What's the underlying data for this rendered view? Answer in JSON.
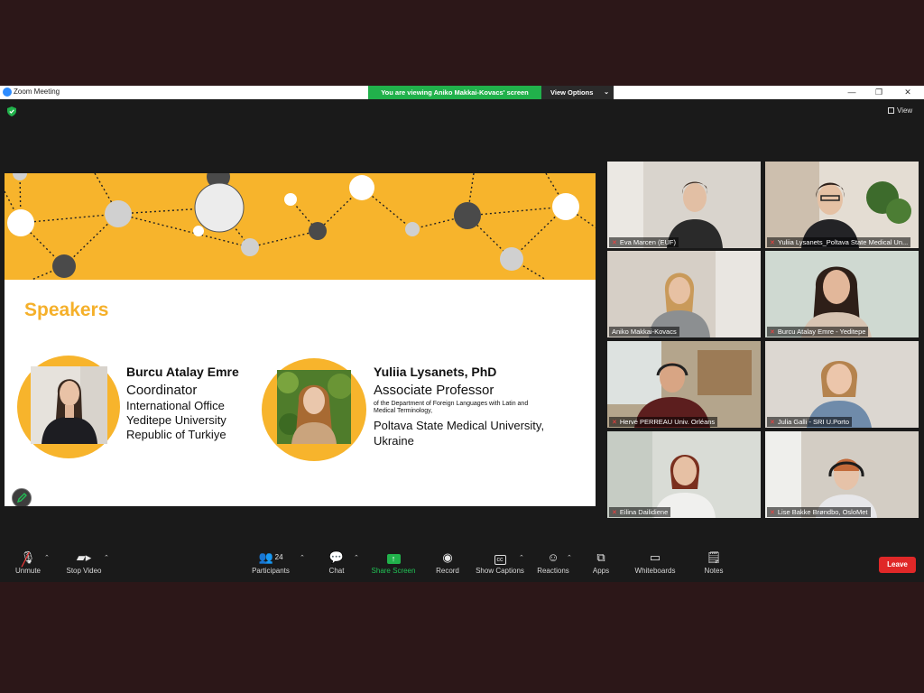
{
  "window": {
    "title": "Zoom Meeting",
    "viewing_banner": "You are viewing Aniko Makkai-Kovacs' screen",
    "view_options": "View Options",
    "view_button": "View"
  },
  "slide": {
    "heading": "Speakers",
    "speaker1": {
      "name": "Burcu Atalay Emre",
      "lines": [
        "Coordinator",
        "International Office",
        "Yeditepe University",
        "Republic of Turkiye"
      ]
    },
    "speaker2": {
      "name": "Yuliia Lysanets, PhD",
      "title": "Associate Professor",
      "dept": [
        "of the Department of Foreign Languages with Latin and",
        "Medical Terminology,"
      ],
      "uni": [
        "Poltava State Medical University,",
        "Ukraine"
      ]
    }
  },
  "participants": [
    {
      "name": "Eva Marcen (EUF)",
      "muted": true
    },
    {
      "name": "Yuliia Lysanets_Poltava State Medical Un...",
      "muted": true
    },
    {
      "name": "Aniko Makkai-Kovacs",
      "muted": false,
      "active": true
    },
    {
      "name": "Burcu Atalay Emre - Yeditepe",
      "muted": true
    },
    {
      "name": "Hervé PERREAU Univ. Orléans",
      "muted": true
    },
    {
      "name": "Julia Galli - SRI U.Porto",
      "muted": true
    },
    {
      "name": "Eilina Dailidiene",
      "muted": true
    },
    {
      "name": "Lise Bakke Brøndbo, OsloMet",
      "muted": true
    }
  ],
  "toolbar": {
    "unmute": "Unmute",
    "stop_video": "Stop Video",
    "participants": "Participants",
    "participants_count": "24",
    "chat": "Chat",
    "share_screen": "Share Screen",
    "record": "Record",
    "show_captions": "Show Captions",
    "reactions": "Reactions",
    "apps": "Apps",
    "whiteboards": "Whiteboards",
    "notes": "Notes",
    "leave": "Leave"
  },
  "colors": {
    "accent_yellow": "#f7b42c",
    "share_green": "#21b14b",
    "leave_red": "#e02828",
    "active_speaker": "#c8e04a"
  }
}
